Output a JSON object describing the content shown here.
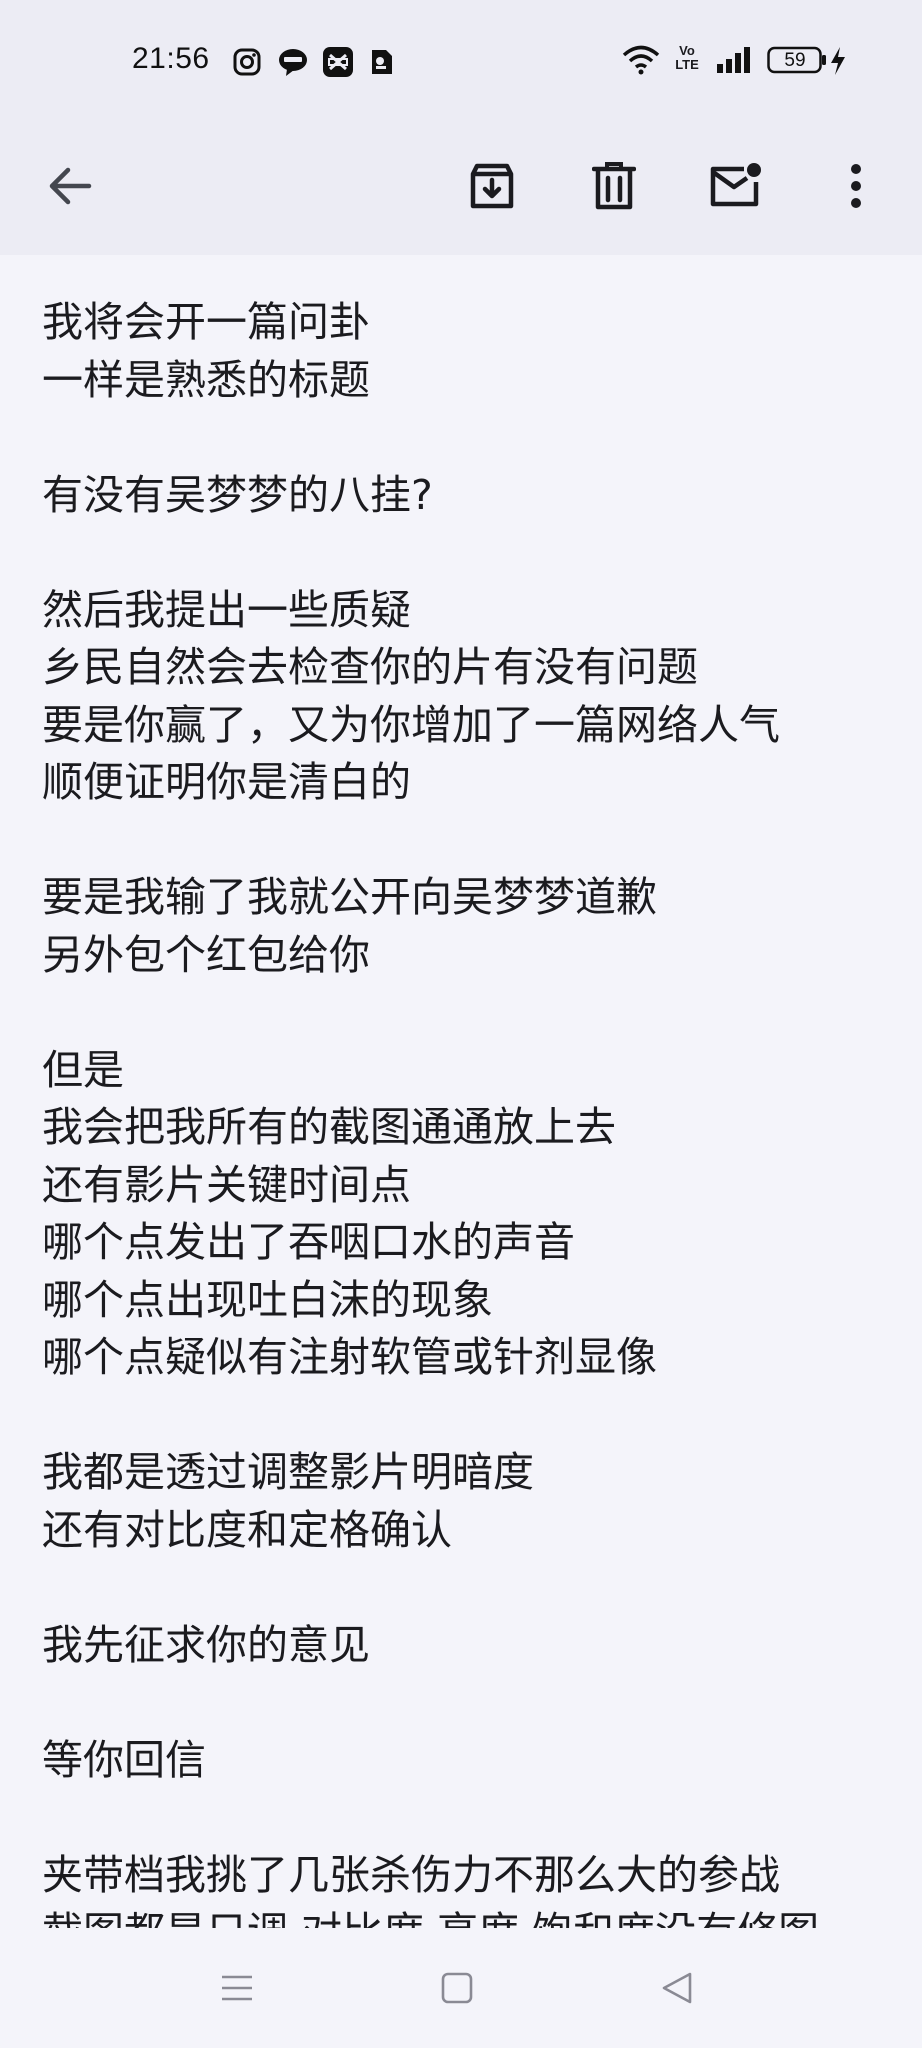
{
  "status_bar": {
    "time": "21:56",
    "battery": "59",
    "network_label": "Vo LTE"
  },
  "toolbar": {
    "icons": [
      "back-arrow-icon",
      "archive-icon",
      "delete-icon",
      "mark-unread-icon",
      "more-vert-icon"
    ]
  },
  "message": {
    "lines": [
      "我将会开一篇问卦",
      "一样是熟悉的标题",
      "",
      "有没有吴梦梦的八挂?",
      "",
      "然后我提出一些质疑",
      "乡民自然会去检查你的片有没有问题",
      "要是你赢了，又为你增加了一篇网络人气",
      "顺便证明你是清白的",
      "",
      "要是我输了我就公开向吴梦梦道歉",
      "另外包个红包给你",
      "",
      "但是",
      "我会把我所有的截图通通放上去",
      "还有影片关键时间点",
      "哪个点发出了吞咽口水的声音",
      "哪个点出现吐白沫的现象",
      "哪个点疑似有注射软管或针剂显像",
      "",
      "我都是透过调整影片明暗度",
      "还有对比度和定格确认",
      "",
      "我先征求你的意见",
      "",
      "等你回信",
      "",
      "夹带档我挑了几张杀伤力不那么大的参战",
      "截图都是只调 对比度 亮度 饱和度没有修图"
    ]
  },
  "nav_bar": {
    "icons": [
      "menu-icon",
      "home-square-icon",
      "back-triangle-icon"
    ]
  }
}
